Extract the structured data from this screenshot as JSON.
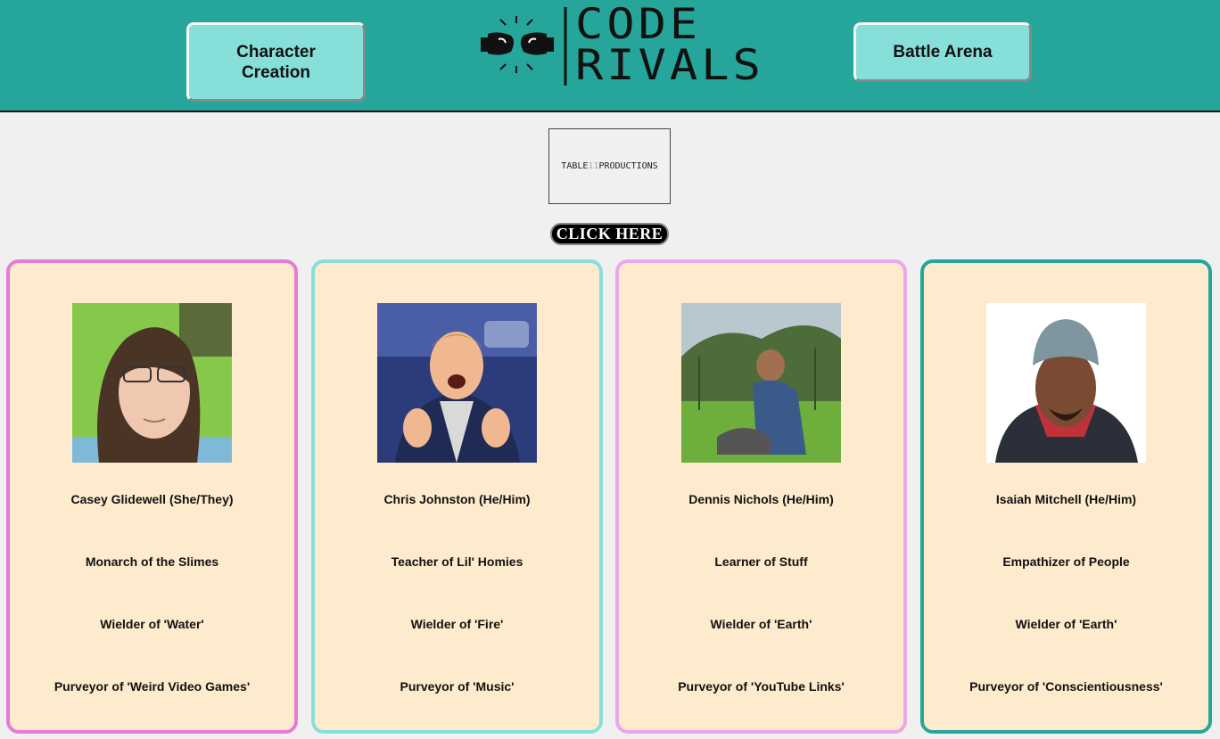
{
  "header": {
    "character_creation_line1": "Character",
    "character_creation_line2": "Creation",
    "battle_arena": "Battle Arena",
    "logo_line1": "CODE",
    "logo_line2": "RIVALS"
  },
  "studio_logo": {
    "part1": "TABLE",
    "part2": "11",
    "part3": "PRODUCTIONS"
  },
  "cta": {
    "label": "CLICK HERE"
  },
  "cards": [
    {
      "name": "Casey Glidewell (She/They)",
      "title": "Monarch of the Slimes",
      "element": "Wielder of 'Water'",
      "interest": "Purveyor of 'Weird Video Games'",
      "border_color": "#e57ad8"
    },
    {
      "name": "Chris Johnston (He/Him)",
      "title": "Teacher of Lil' Homies",
      "element": "Wielder of 'Fire'",
      "interest": "Purveyor of 'Music'",
      "border_color": "#87dfd9"
    },
    {
      "name": "Dennis Nichols (He/Him)",
      "title": "Learner of Stuff",
      "element": "Wielder of 'Earth'",
      "interest": "Purveyor of 'YouTube Links'",
      "border_color": "#eba7ea"
    },
    {
      "name": "Isaiah Mitchell (He/Him)",
      "title": "Empathizer of People",
      "element": "Wielder of 'Earth'",
      "interest": "Purveyor of 'Conscientiousness'",
      "border_color": "#26a69a"
    }
  ],
  "colors": {
    "header_bg": "#26a69a",
    "button_bg": "#87dfd9",
    "card_bg": "#feebcd",
    "page_bg": "#f0f0f0"
  },
  "icons": [
    "boxing-gloves-icon"
  ]
}
